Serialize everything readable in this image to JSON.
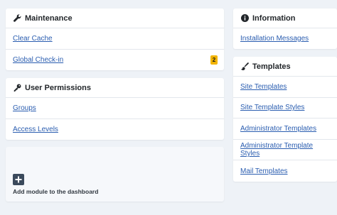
{
  "colors": {
    "page_background": "#eef2f7",
    "card_background": "#ffffff",
    "link": "#2a5db0",
    "badge": "#f2b400"
  },
  "maintenance": {
    "title": "Maintenance",
    "icon": "wrench-icon",
    "items": [
      {
        "label": "Clear Cache"
      },
      {
        "label": "Global Check-in",
        "badge": "2"
      }
    ]
  },
  "user_permissions": {
    "title": "User Permissions",
    "icon": "key-icon",
    "items": [
      {
        "label": "Groups"
      },
      {
        "label": "Access Levels"
      }
    ]
  },
  "add_module": {
    "icon": "plus-square-icon",
    "label": "Add module to the dashboard"
  },
  "information": {
    "title": "Information",
    "icon": "info-circle-icon",
    "items": [
      {
        "label": "Installation Messages"
      }
    ]
  },
  "templates": {
    "title": "Templates",
    "icon": "paint-brush-icon",
    "items": [
      {
        "label": "Site Templates"
      },
      {
        "label": "Site Template Styles"
      },
      {
        "label": "Administrator Templates"
      },
      {
        "label": "Administrator Template Styles"
      },
      {
        "label": "Mail Templates"
      }
    ]
  }
}
